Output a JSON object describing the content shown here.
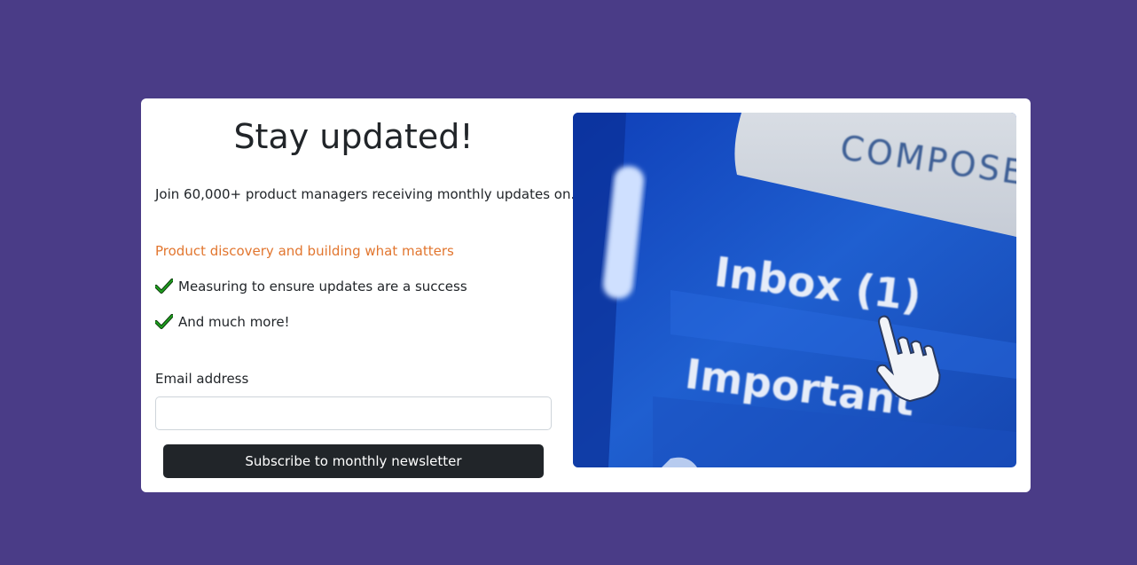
{
  "card": {
    "title": "Stay updated!",
    "lead": "Join 60,000+ product managers receiving monthly updates on.",
    "features": [
      {
        "text": "Product discovery and building what matters",
        "icon": ""
      },
      {
        "text": "Measuring to ensure updates are a success",
        "icon": "check-icon"
      },
      {
        "text": "And much more!",
        "icon": "check-icon"
      }
    ],
    "email_label": "Email address",
    "email_value": "",
    "email_placeholder": "",
    "subscribe_label": "Subscribe to monthly newsletter"
  },
  "hero_image": {
    "compose_text": "COMPOSE",
    "inbox_text": "Inbox (1)",
    "important_text": "Important"
  },
  "colors": {
    "background": "#4a3c87",
    "accent": "#e2762f",
    "button": "#212529",
    "check": "#1a7a1a"
  }
}
